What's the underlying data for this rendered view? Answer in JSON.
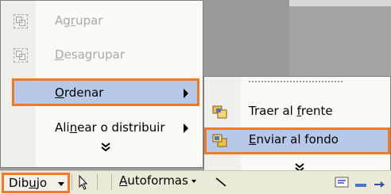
{
  "main_menu": {
    "items": [
      {
        "label": "Agrupar",
        "enabled": false,
        "icon": "group-icon"
      },
      {
        "label": "Desagrupar",
        "enabled": false,
        "icon": "ungroup-icon"
      },
      {
        "label": "Ordenar",
        "enabled": true,
        "highlighted": true,
        "has_submenu": true
      },
      {
        "label": "Alinear o distribuir",
        "enabled": true,
        "has_submenu": true
      }
    ],
    "expand": "chevron-down-icon"
  },
  "submenu": {
    "items": [
      {
        "label": "Traer al frente",
        "icon": "bring-to-front-icon"
      },
      {
        "label": "Enviar al fondo",
        "icon": "send-to-back-icon",
        "highlighted": true
      }
    ],
    "expand": "chevron-down-icon"
  },
  "toolbar": {
    "dibujo_label": "Dibujo",
    "autoformas_label": "Autoformas"
  },
  "colors": {
    "highlight_border": "#f07a2a",
    "menu_selected": "#b8c8e8",
    "menu_bg": "#fbfaf6",
    "toolbar_bg": "#ece9d8"
  }
}
